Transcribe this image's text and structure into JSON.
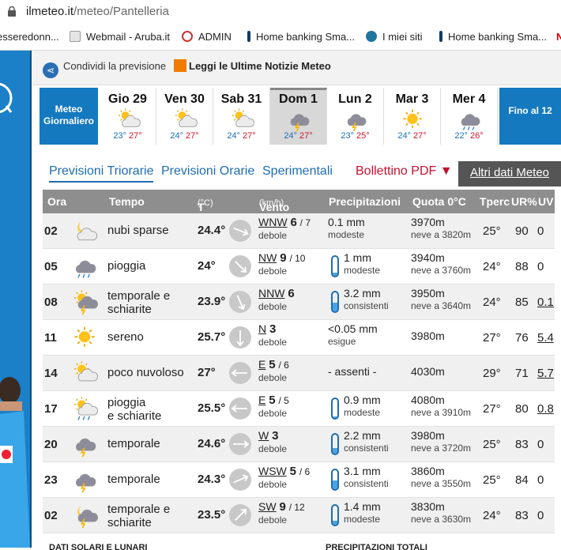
{
  "browser": {
    "url_host": "ilmeteo.it",
    "url_path": "/meteo/Pantelleria"
  },
  "bookmarks": [
    {
      "label": "esseredonn...",
      "icon": "bookmark-icon"
    },
    {
      "label": "Webmail - Aruba.it",
      "icon": "webmail-icon"
    },
    {
      "label": "ADMIN",
      "icon": "admin-icon"
    },
    {
      "label": "Home banking Sma...",
      "icon": "bank-icon"
    },
    {
      "label": "I miei siti",
      "icon": "wordpress-icon"
    },
    {
      "label": "Home banking Sma...",
      "icon": "bank-icon"
    }
  ],
  "share": {
    "share_label": "Condividi la previsione",
    "news_label": "Leggi le Ultime Notizie Meteo"
  },
  "days": {
    "meteo_giornaliero": "Meteo Giornaliero",
    "fino": "Fino al 12",
    "items": [
      {
        "name": "Gio 29",
        "min": "23°",
        "max": "27°",
        "icon": "partly-cloudy-icon"
      },
      {
        "name": "Ven 30",
        "min": "24°",
        "max": "27°",
        "icon": "partly-cloudy-icon"
      },
      {
        "name": "Sab 31",
        "min": "24°",
        "max": "27°",
        "icon": "partly-cloudy-icon"
      },
      {
        "name": "Dom 1",
        "min": "24°",
        "max": "27°",
        "icon": "thunderstorm-icon"
      },
      {
        "name": "Lun 2",
        "min": "23°",
        "max": "25°",
        "icon": "thunderstorm-icon"
      },
      {
        "name": "Mar 3",
        "min": "24°",
        "max": "27°",
        "icon": "sun-icon"
      },
      {
        "name": "Mer 4",
        "min": "22°",
        "max": "26°",
        "icon": "rain-icon"
      }
    ]
  },
  "tabs": {
    "triorarie": "Previsioni Triorarie",
    "orarie": "Previsioni Orarie",
    "sperimentali": "Sperimentali",
    "bollettino": "Bollettino PDF ▼",
    "altri": "Altri dati Meteo"
  },
  "table": {
    "headers": {
      "ora": "Ora",
      "tempo": "Tempo",
      "t": "T",
      "t_unit": "(°C)",
      "vento": "Vento",
      "vento_unit": "(km/h)",
      "precip": "Precipitazioni",
      "quota": "Quota 0°C",
      "tperc": "Tperc",
      "ur": "UR%",
      "uv": "UV"
    },
    "rows": [
      {
        "ora": "02",
        "desc1": "nubi sparse",
        "desc2": "",
        "temp": "24.4°",
        "dir": "WNW",
        "speed": "6",
        "max": "/ 7",
        "wlabel": "debole",
        "precip": "0.1 mm",
        "plabel": "modeste",
        "quota": "3970m",
        "quota2": "neve a 3820m",
        "tperc": "25°",
        "ur": "90",
        "uv": "0",
        "icon": "moon-cloud-icon",
        "wind_deg": 292,
        "gauge": 0
      },
      {
        "ora": "05",
        "desc1": "pioggia",
        "desc2": "",
        "temp": "24°",
        "dir": "NW",
        "speed": "9",
        "max": "/ 10",
        "wlabel": "debole",
        "precip": "1 mm",
        "plabel": "modeste",
        "quota": "3940m",
        "quota2": "neve a 3760m",
        "tperc": "24°",
        "ur": "88",
        "uv": "0",
        "icon": "rain-cloud-icon",
        "wind_deg": 315,
        "gauge": 0.15
      },
      {
        "ora": "08",
        "desc1": "temporale e",
        "desc2": "schiarite",
        "temp": "23.9°",
        "dir": "NNW",
        "speed": "6",
        "max": "",
        "wlabel": "debole",
        "precip": "3.2 mm",
        "plabel": "consistenti",
        "quota": "3950m",
        "quota2": "neve a 3640m",
        "tperc": "24°",
        "ur": "85",
        "uv": "0.1",
        "icon": "thunder-sun-icon",
        "wind_deg": 337,
        "gauge": 0.45
      },
      {
        "ora": "11",
        "desc1": "sereno",
        "desc2": "",
        "temp": "25.7°",
        "dir": "N",
        "speed": "3",
        "max": "",
        "wlabel": "debole",
        "precip": "<0.05 mm",
        "plabel": "esigue",
        "quota": "3980m",
        "quota2": "",
        "tperc": "27°",
        "ur": "76",
        "uv": "5.4",
        "icon": "sun-icon",
        "wind_deg": 0,
        "gauge": 0
      },
      {
        "ora": "14",
        "desc1": "poco nuvoloso",
        "desc2": "",
        "temp": "27°",
        "dir": "E",
        "speed": "5",
        "max": "/ 6",
        "wlabel": "debole",
        "precip": "- assenti -",
        "plabel": "",
        "quota": "4030m",
        "quota2": "",
        "tperc": "29°",
        "ur": "71",
        "uv": "5.7",
        "icon": "partly-cloudy-icon",
        "wind_deg": 90,
        "gauge": 0
      },
      {
        "ora": "17",
        "desc1": "pioggia",
        "desc2": "e schiarite",
        "temp": "25.5°",
        "dir": "E",
        "speed": "5",
        "max": "/ 5",
        "wlabel": "debole",
        "precip": "0.9 mm",
        "plabel": "modeste",
        "quota": "4080m",
        "quota2": "neve a 3910m",
        "tperc": "27°",
        "ur": "80",
        "uv": "0.8",
        "icon": "sun-rain-icon",
        "wind_deg": 90,
        "gauge": 0.1
      },
      {
        "ora": "20",
        "desc1": "temporale",
        "desc2": "",
        "temp": "24.6°",
        "dir": "W",
        "speed": "3",
        "max": "",
        "wlabel": "debole",
        "precip": "2.2 mm",
        "plabel": "consistenti",
        "quota": "3980m",
        "quota2": "neve a 3720m",
        "tperc": "25°",
        "ur": "83",
        "uv": "0",
        "icon": "thunderstorm-icon",
        "wind_deg": 270,
        "gauge": 0.3
      },
      {
        "ora": "23",
        "desc1": "temporale",
        "desc2": "",
        "temp": "24.3°",
        "dir": "WSW",
        "speed": "5",
        "max": "/ 6",
        "wlabel": "debole",
        "precip": "3.1 mm",
        "plabel": "consistenti",
        "quota": "3860m",
        "quota2": "neve a 3550m",
        "tperc": "25°",
        "ur": "84",
        "uv": "0",
        "icon": "thunderstorm-icon",
        "wind_deg": 247,
        "gauge": 0.45
      },
      {
        "ora": "02",
        "desc1": "temporale e",
        "desc2": "schiarite",
        "temp": "23.5°",
        "dir": "SW",
        "speed": "9",
        "max": "/ 12",
        "wlabel": "debole",
        "precip": "1.4 mm",
        "plabel": "modeste",
        "quota": "3830m",
        "quota2": "neve a 3630m",
        "tperc": "24°",
        "ur": "83",
        "uv": "0",
        "icon": "thunder-moon-icon",
        "wind_deg": 225,
        "gauge": 0.2
      }
    ]
  },
  "footer_text": [
    "DATI SOLARI E LUNARI",
    "PRECIPITAZIONI TOTALI"
  ],
  "colors": {
    "accent": "#1579c0",
    "max_temp": "#d2142b",
    "min_temp": "#1a6fb5"
  }
}
